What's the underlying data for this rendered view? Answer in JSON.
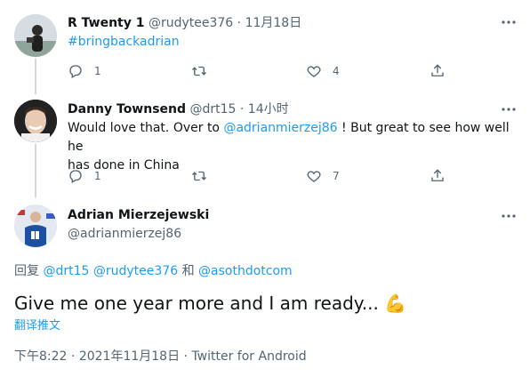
{
  "tweets": [
    {
      "name": "R Twenty 1",
      "handle": "@rudytee376",
      "sep": "·",
      "time": "11月18日",
      "text_link": "#bringbackadrian",
      "reply_count": "1",
      "like_count": "4"
    },
    {
      "name": "Danny Townsend",
      "handle": "@drt15",
      "sep": "·",
      "time": "14小时",
      "text_line1_pre": "Would love that. Over to ",
      "text_line1_link": "@adrianmierzej86",
      "text_line1_post": " ! But great to see how well he",
      "text_line2": "has done in China",
      "reply_count": "1",
      "like_count": "7"
    }
  ],
  "main_tweet": {
    "name": "Adrian Mierzejewski",
    "handle": "@adrianmierzej86",
    "reply_prefix": "回复",
    "reply_to_1": "@drt15",
    "reply_to_2": "@rudytee376",
    "reply_and": "和",
    "reply_to_3": "@asothdotcom",
    "text": "Give me one year more and I am ready...",
    "emoji": "💪",
    "translate": "翻译推文",
    "time": "下午8:22",
    "sep1": "·",
    "date": "2021年11月18日",
    "sep2": "·",
    "source": "Twitter for Android"
  },
  "colors": {
    "link": "#1d9bf0",
    "meta": "#536471",
    "thread_line": "#cfd9de"
  },
  "icons": [
    "reply-icon",
    "retweet-icon",
    "like-icon",
    "share-icon",
    "more-icon"
  ]
}
